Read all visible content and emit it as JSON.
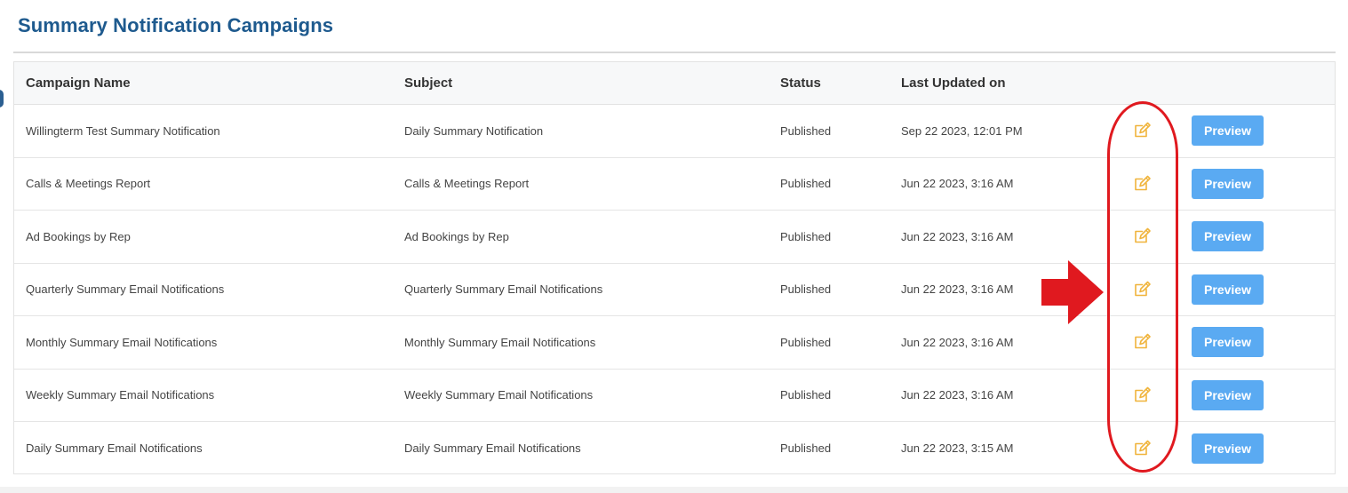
{
  "page": {
    "title": "Summary Notification Campaigns"
  },
  "table": {
    "headers": {
      "name": "Campaign Name",
      "subject": "Subject",
      "status": "Status",
      "updated": "Last Updated on"
    },
    "rows": [
      {
        "name": "Willingterm Test Summary Notification",
        "subject": "Daily Summary Notification",
        "status": "Published",
        "updated": "Sep 22 2023, 12:01 PM",
        "action": "Preview"
      },
      {
        "name": "Calls & Meetings Report",
        "subject": "Calls & Meetings Report",
        "status": "Published",
        "updated": "Jun 22 2023, 3:16 AM",
        "action": "Preview"
      },
      {
        "name": "Ad Bookings by Rep",
        "subject": "Ad Bookings by Rep",
        "status": "Published",
        "updated": "Jun 22 2023, 3:16 AM",
        "action": "Preview"
      },
      {
        "name": "Quarterly Summary Email Notifications",
        "subject": "Quarterly Summary Email Notifications",
        "status": "Published",
        "updated": "Jun 22 2023, 3:16 AM",
        "action": "Preview"
      },
      {
        "name": "Monthly Summary Email Notifications",
        "subject": "Monthly Summary Email Notifications",
        "status": "Published",
        "updated": "Jun 22 2023, 3:16 AM",
        "action": "Preview"
      },
      {
        "name": "Weekly Summary Email Notifications",
        "subject": "Weekly Summary Email Notifications",
        "status": "Published",
        "updated": "Jun 22 2023, 3:16 AM",
        "action": "Preview"
      },
      {
        "name": "Daily Summary Email Notifications",
        "subject": "Daily Summary Email Notifications",
        "status": "Published",
        "updated": "Jun 22 2023, 3:15 AM",
        "action": "Preview"
      }
    ]
  },
  "icons": {
    "edit": "edit-pencil-icon",
    "annotation_arrow": "arrow-right-icon"
  },
  "colors": {
    "title": "#1e5a8e",
    "preview_button": "#5aaaf2",
    "edit_icon": "#f0b43c",
    "annotation": "#e0191f"
  }
}
